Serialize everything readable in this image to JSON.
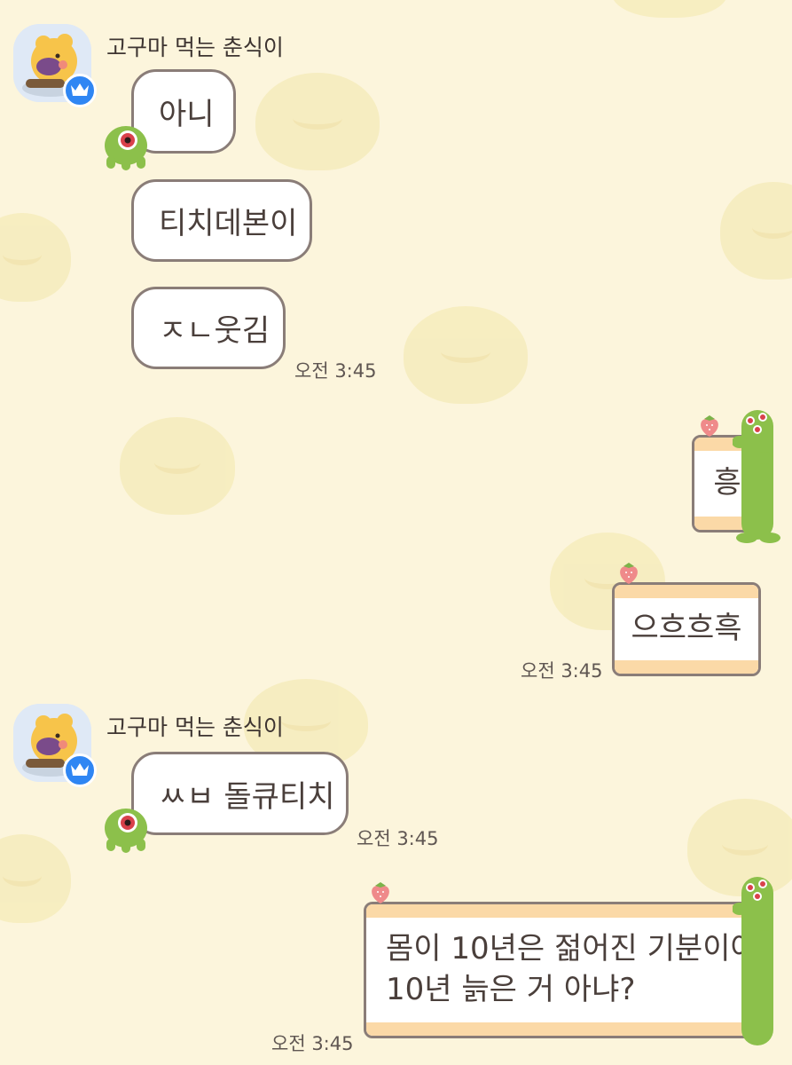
{
  "colors": {
    "background": "#fcf5dc",
    "bubble_border": "#8a7d78",
    "card_stripe": "#fbd9a7",
    "badge_blue": "#2f86f3",
    "critter_green": "#8cc04b"
  },
  "messages": {
    "group1": {
      "sender": "고구마 먹는 춘식이",
      "bubbles": [
        "아니",
        "티치데본이",
        "ㅈㄴ웃김"
      ],
      "time": "오전 3:45"
    },
    "outgoing1": {
      "bubbles": [
        "흥",
        "으흐흐흑"
      ],
      "time": "오전 3:45"
    },
    "group2": {
      "sender": "고구마 먹는 춘식이",
      "bubbles": [
        "ㅆㅂ 돌큐티치"
      ],
      "time": "오전 3:45"
    },
    "outgoing2": {
      "line1": "몸이 10년은 젊어진 기분이야!",
      "line2": "10년 늙은 거 아냐?",
      "time": "오전 3:45"
    }
  },
  "icons": {
    "avatar": "chunsik-eating-sweet-potato-avatar",
    "badge": "crown-icon",
    "critter": "green-one-eyed-critter-icon",
    "card_decor": "strawberry-icon"
  }
}
